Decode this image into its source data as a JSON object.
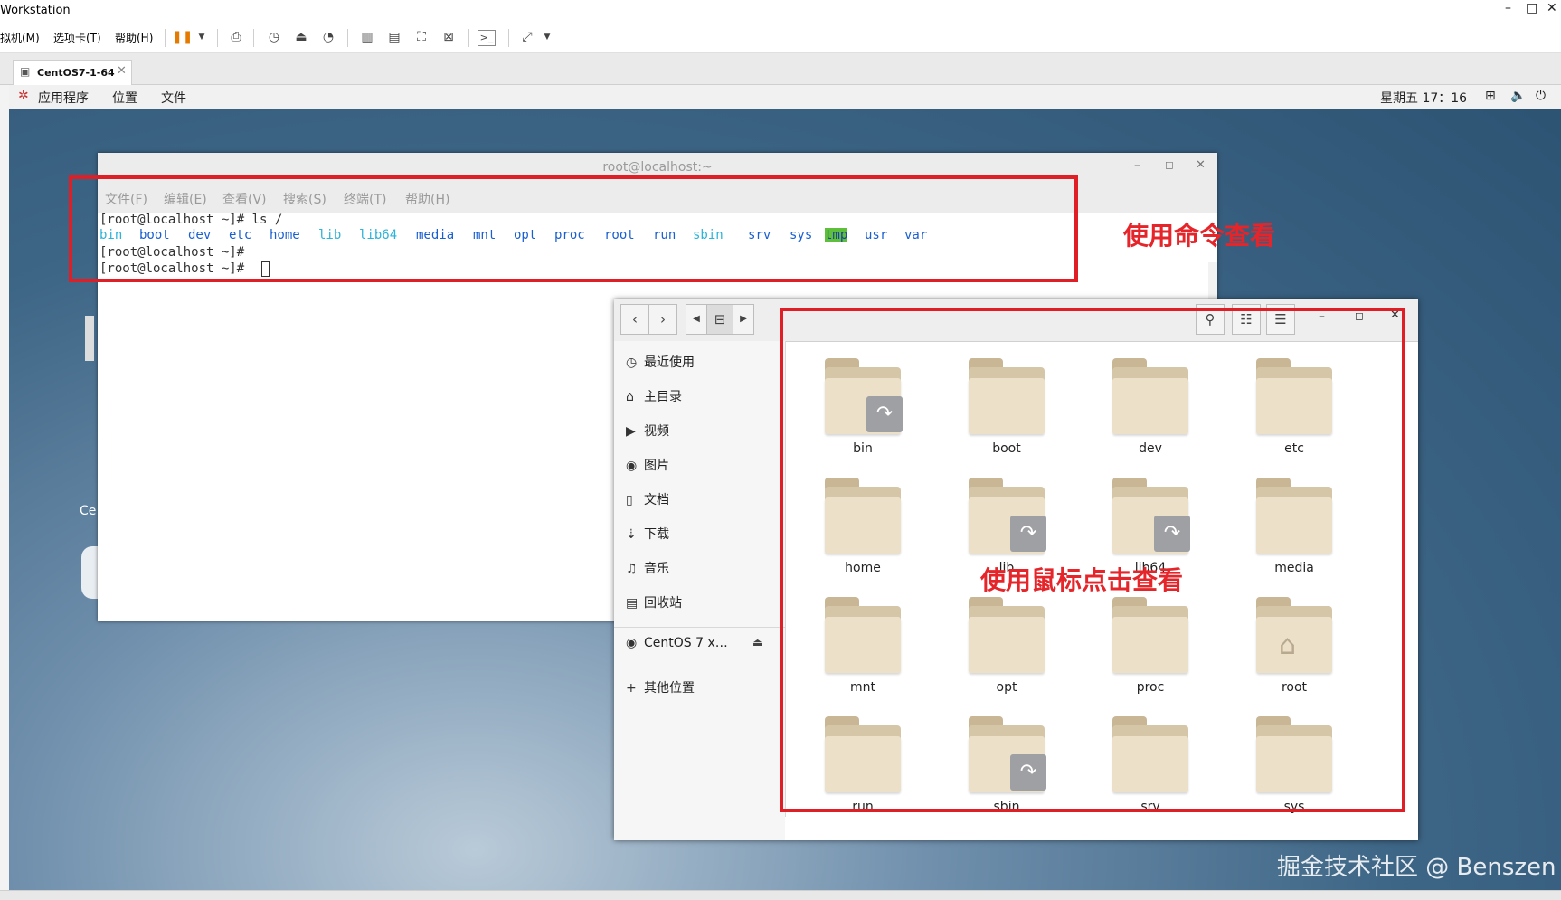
{
  "vmware": {
    "title": "Workstation",
    "window_controls": [
      "–",
      "□",
      "✕"
    ],
    "menu": [
      "拟机(M)",
      "选项卡(T)",
      "帮助(H)"
    ],
    "tab_label": "CentOS7-1-64"
  },
  "gnome": {
    "apps": "应用程序",
    "places": "位置",
    "files": "文件",
    "clock": "星期五 17：16"
  },
  "desktop": {
    "icon_label": "Ce"
  },
  "terminal": {
    "title": "root@localhost:~",
    "menu": [
      "文件(F)",
      "编辑(E)",
      "查看(V)",
      "搜索(S)",
      "终端(T)",
      "帮助(H)"
    ],
    "lines": [
      "[root@localhost ~]# ls /",
      "[root@localhost ~]#",
      "[root@localhost ~]# "
    ],
    "ls_output": [
      {
        "name": "bin",
        "color": "#2bb3d8"
      },
      {
        "name": "boot",
        "color": "#1a5fd0"
      },
      {
        "name": "dev",
        "color": "#1a5fd0"
      },
      {
        "name": "etc",
        "color": "#1a5fd0"
      },
      {
        "name": "home",
        "color": "#1a5fd0"
      },
      {
        "name": "lib",
        "color": "#2bb3d8"
      },
      {
        "name": "lib64",
        "color": "#2bb3d8"
      },
      {
        "name": "media",
        "color": "#1a5fd0"
      },
      {
        "name": "mnt",
        "color": "#1a5fd0"
      },
      {
        "name": "opt",
        "color": "#1a5fd0"
      },
      {
        "name": "proc",
        "color": "#1a5fd0"
      },
      {
        "name": "root",
        "color": "#1a5fd0"
      },
      {
        "name": "run",
        "color": "#1a5fd0"
      },
      {
        "name": "sbin",
        "color": "#2bb3d8"
      },
      {
        "name": "srv",
        "color": "#1a5fd0"
      },
      {
        "name": "sys",
        "color": "#1a5fd0"
      },
      {
        "name": "tmp",
        "color": "#1a5fd0",
        "highlight": "#5ec03a"
      },
      {
        "name": "usr",
        "color": "#1a5fd0"
      },
      {
        "name": "var",
        "color": "#1a5fd0"
      }
    ]
  },
  "file_manager": {
    "sidebar": [
      {
        "icon": "clock-icon",
        "glyph": "◷",
        "label": "最近使用"
      },
      {
        "icon": "home-icon",
        "glyph": "⌂",
        "label": "主目录"
      },
      {
        "icon": "video-icon",
        "glyph": "▶",
        "label": "视频"
      },
      {
        "icon": "camera-icon",
        "glyph": "◉",
        "label": "图片"
      },
      {
        "icon": "document-icon",
        "glyph": "▯",
        "label": "文档"
      },
      {
        "icon": "download-icon",
        "glyph": "⇣",
        "label": "下载"
      },
      {
        "icon": "music-icon",
        "glyph": "♫",
        "label": "音乐"
      },
      {
        "icon": "trash-icon",
        "glyph": "▤",
        "label": "回收站"
      }
    ],
    "device": {
      "label": "CentOS 7 x…",
      "icon": "disc-icon"
    },
    "other": {
      "label": "其他位置",
      "icon": "plus-icon"
    },
    "folders": [
      {
        "name": "bin",
        "link": true
      },
      {
        "name": "boot",
        "link": false
      },
      {
        "name": "dev",
        "link": false
      },
      {
        "name": "etc",
        "link": false
      },
      {
        "name": "home",
        "link": false
      },
      {
        "name": "lib",
        "link": true
      },
      {
        "name": "lib64",
        "link": true
      },
      {
        "name": "media",
        "link": false
      },
      {
        "name": "mnt",
        "link": false
      },
      {
        "name": "opt",
        "link": false
      },
      {
        "name": "proc",
        "link": false
      },
      {
        "name": "root",
        "link": false,
        "home": true
      },
      {
        "name": "run",
        "link": false
      },
      {
        "name": "sbin",
        "link": true
      },
      {
        "name": "srv",
        "link": false
      },
      {
        "name": "sys",
        "link": false
      }
    ]
  },
  "annotations": {
    "command": "使用命令查看",
    "mouse": "使用鼠标点击查看"
  },
  "watermark": "掘金技术社区 @ Benszen"
}
